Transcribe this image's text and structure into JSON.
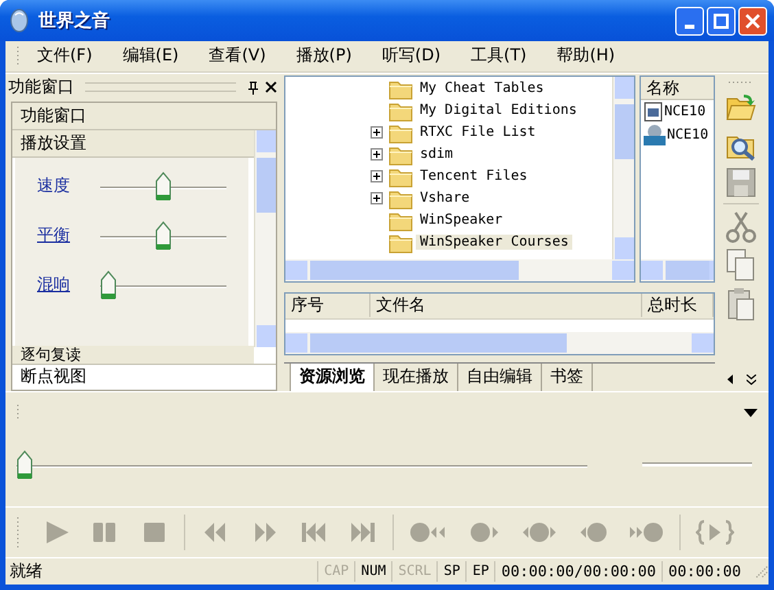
{
  "window": {
    "title": "世界之音"
  },
  "menu": [
    {
      "label": "文件(F)"
    },
    {
      "label": "编辑(E)"
    },
    {
      "label": "查看(V)"
    },
    {
      "label": "播放(P)"
    },
    {
      "label": "听写(D)"
    },
    {
      "label": "工具(T)"
    },
    {
      "label": "帮助(H)"
    }
  ],
  "side_panel": {
    "title": "功能窗口",
    "header": "功能窗口",
    "section": "播放设置",
    "sliders": [
      {
        "label": "速度",
        "level": 0.5
      },
      {
        "label": "平衡",
        "level": 0.5
      },
      {
        "label": "混响",
        "level": 0
      }
    ],
    "next_section": "逐句复读",
    "footer": "断点视图"
  },
  "tree": {
    "items": [
      {
        "label": "My Cheat Tables",
        "expandable": false,
        "selected": false
      },
      {
        "label": "My Digital Editions",
        "expandable": false,
        "selected": false
      },
      {
        "label": "RTXC File List",
        "expandable": true,
        "selected": false
      },
      {
        "label": "sdim",
        "expandable": true,
        "selected": false
      },
      {
        "label": "Tencent Files",
        "expandable": true,
        "selected": false
      },
      {
        "label": "Vshare",
        "expandable": true,
        "selected": false
      },
      {
        "label": "WinSpeaker",
        "expandable": false,
        "selected": false
      },
      {
        "label": "WinSpeaker Courses",
        "expandable": false,
        "selected": true
      }
    ]
  },
  "file_list": {
    "column": "名称",
    "files": [
      {
        "name": "NCE10",
        "kind": "subtitle"
      },
      {
        "name": "NCE10",
        "kind": "audio"
      }
    ]
  },
  "playlist": {
    "columns": [
      "序号",
      "文件名",
      "总时长"
    ]
  },
  "tabs": [
    {
      "label": "资源浏览",
      "selected": true
    },
    {
      "label": "现在播放",
      "selected": false
    },
    {
      "label": "自由编辑",
      "selected": false
    },
    {
      "label": "书签",
      "selected": false
    }
  ],
  "seek": {
    "level": 0
  },
  "status_bar": {
    "text": "就绪",
    "indicators": [
      {
        "label": "CAP",
        "on": false
      },
      {
        "label": "NUM",
        "on": true
      },
      {
        "label": "SCRL",
        "on": false
      },
      {
        "label": "SP",
        "on": true
      },
      {
        "label": "EP",
        "on": true
      }
    ],
    "position": "00:00:00/00:00:00",
    "time": "00:00:00"
  }
}
